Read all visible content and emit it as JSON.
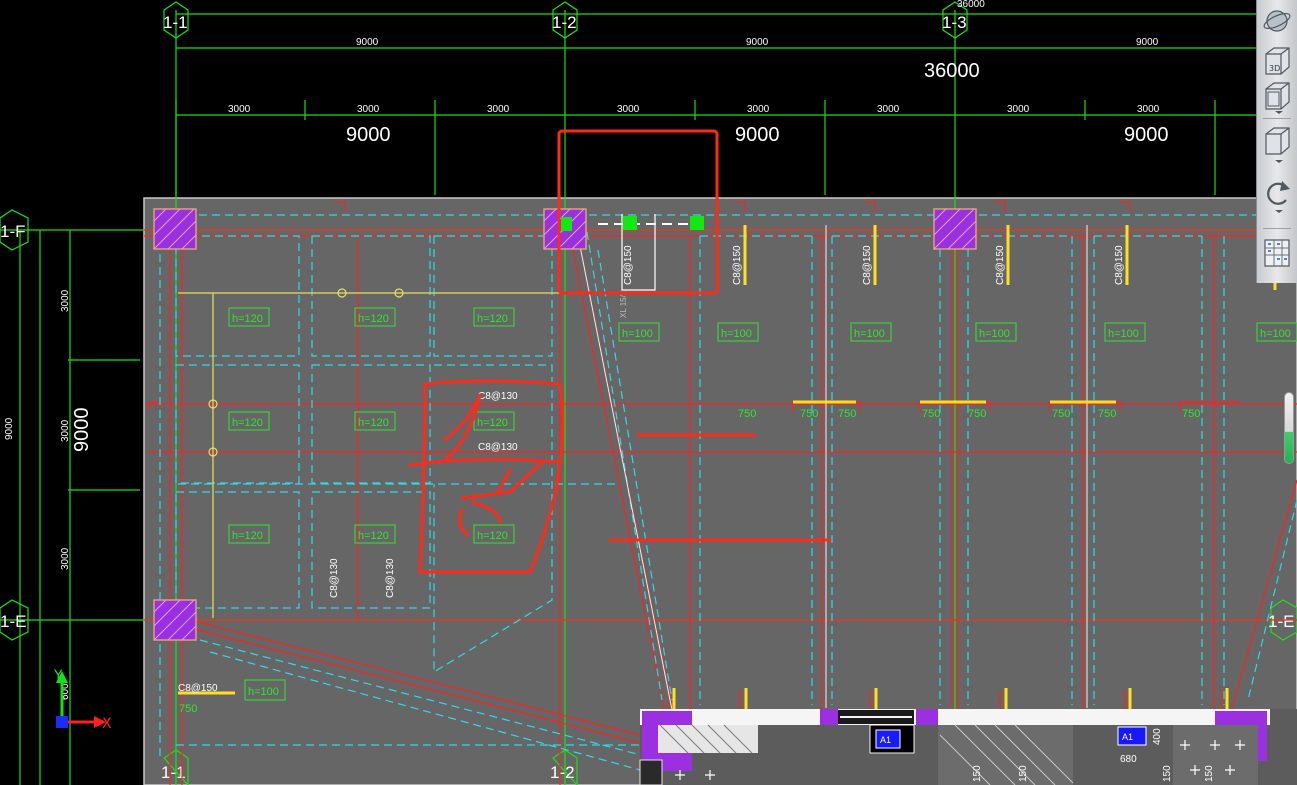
{
  "grid": {
    "cols": [
      "1-1",
      "1-2",
      "1-3"
    ],
    "rows": [
      "1-F",
      "1-E"
    ],
    "right_row_label": "1-E",
    "col_span_small": "9000",
    "overall_dim": "36000",
    "overall_dim_top": "36000",
    "bay_dim": "9000",
    "sub_dim": "3000",
    "left_span": "9000",
    "left_sub": "3000",
    "left_outer": "9000"
  },
  "labels": {
    "slab_thk_120": "h=120",
    "slab_thk_100": "h=100",
    "rebar_c8_130": "C8@130",
    "rebar_c8_150": "C8@150",
    "dim_750": "750",
    "dim_680": "680",
    "dim_400": "400",
    "misc_150": "150",
    "misc_600": "600",
    "tag_xl": "XL 15/2",
    "box_a": "A1"
  },
  "ucs": {
    "x_label": "X",
    "y_label": "Y"
  },
  "navbar": {
    "buttons": [
      "orbit-icon",
      "view-3d-icon",
      "view-cube-front-icon",
      "view-cube-icon",
      "refresh-rotate-icon",
      "layer-grid-icon"
    ],
    "btn_3d_text": "3D"
  },
  "colors": {
    "slab_fill": "#6a6a6a",
    "grid_green": "#18e018",
    "beam_red": "#ff2020",
    "cyan_dash": "#2fd9e8",
    "column_purple": "#9b30e0",
    "annotation_red": "#ff2a1a"
  }
}
